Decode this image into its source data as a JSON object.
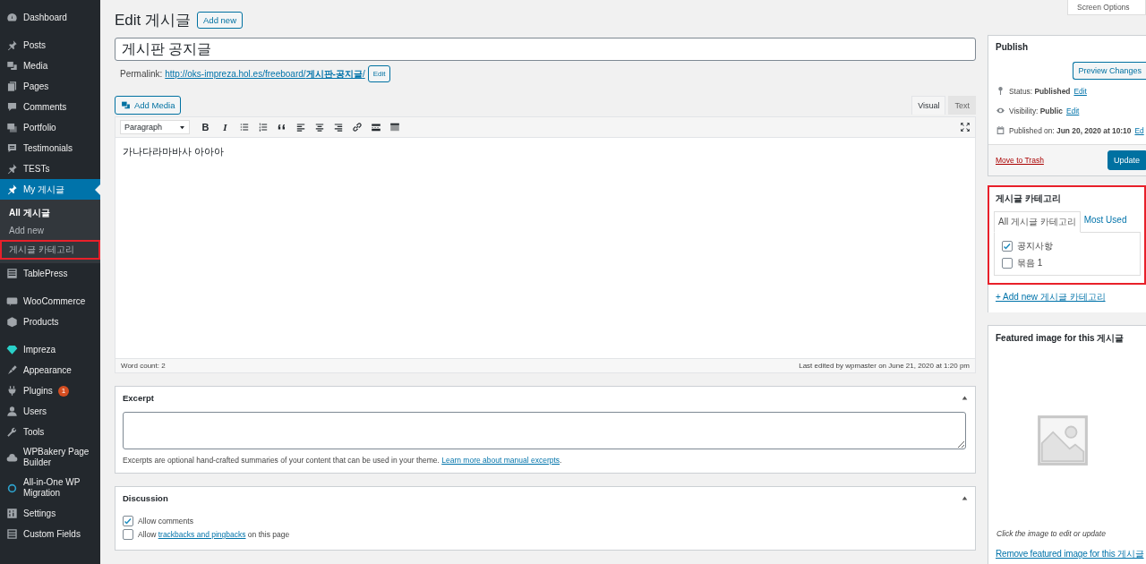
{
  "sidebar": {
    "groups": [
      [
        {
          "label": "Dashboard",
          "kind": "dashboard",
          "selected": false
        }
      ],
      [
        {
          "label": "Posts",
          "kind": "pin",
          "selected": false
        },
        {
          "label": "Media",
          "kind": "media",
          "selected": false
        },
        {
          "label": "Pages",
          "kind": "pages",
          "selected": false
        },
        {
          "label": "Comments",
          "kind": "comment",
          "selected": false
        },
        {
          "label": "Portfolio",
          "kind": "portfolio",
          "selected": false
        },
        {
          "label": "Testimonials",
          "kind": "testimonial",
          "selected": false
        },
        {
          "label": "TESTs",
          "kind": "pin",
          "selected": false
        },
        {
          "label": "My 게시글",
          "kind": "pin",
          "selected": true,
          "children": [
            {
              "label": "All 게시글",
              "selected": true,
              "highlighted": false
            },
            {
              "label": "Add new",
              "selected": false,
              "highlighted": false
            },
            {
              "label": "게시글 카테고리",
              "selected": false,
              "highlighted": true
            }
          ]
        },
        {
          "label": "TablePress",
          "kind": "table",
          "selected": false
        }
      ],
      [
        {
          "label": "WooCommerce",
          "kind": "woo",
          "selected": false
        },
        {
          "label": "Products",
          "kind": "box",
          "selected": false
        }
      ],
      [
        {
          "label": "Impreza",
          "kind": "gem",
          "selected": false
        },
        {
          "label": "Appearance",
          "kind": "brush",
          "selected": false
        },
        {
          "label": "Plugins",
          "kind": "plug",
          "selected": false,
          "badge": "1"
        },
        {
          "label": "Users",
          "kind": "user",
          "selected": false
        },
        {
          "label": "Tools",
          "kind": "wrench",
          "selected": false
        },
        {
          "label": "WPBakery Page Builder",
          "kind": "cloud",
          "selected": false
        },
        {
          "label": "All-in-One WP Migration",
          "kind": "migration",
          "selected": false
        },
        {
          "label": "Settings",
          "kind": "settings",
          "selected": false
        },
        {
          "label": "Custom Fields",
          "kind": "fields",
          "selected": false
        }
      ]
    ]
  },
  "page": {
    "title": "Edit 게시글",
    "add_new": "Add new",
    "post_title": "게시판 공지글",
    "permalink": {
      "label": "Permalink:",
      "url": "http://oks-impreza.hol.es/freeboard/**게시판-공지글**/",
      "edit": "Edit"
    },
    "add_media": "Add Media",
    "editor": {
      "tabs": [
        {
          "label": "Visual",
          "selected": true
        },
        {
          "label": "Text",
          "selected": false
        }
      ],
      "format": "Paragraph",
      "tools": [
        {
          "kind": "text",
          "label": "B"
        },
        {
          "kind": "italic",
          "label": "I"
        },
        {
          "kind": "bullets"
        },
        {
          "kind": "numbers"
        },
        {
          "kind": "quote"
        },
        {
          "kind": "align-left"
        },
        {
          "kind": "align-center"
        },
        {
          "kind": "align-right"
        },
        {
          "kind": "link"
        },
        {
          "kind": "more"
        },
        {
          "kind": "toolbar"
        }
      ],
      "content": "가나다라마바사 아아아",
      "word_count": "Word count: 2",
      "last_edited": "Last edited by wpmaster on June 21, 2020 at 1:20 pm"
    },
    "excerpt": {
      "title": "Excerpt",
      "help": "Excerpts are optional hand-crafted summaries of your content that can be used in your theme.",
      "link": "Learn more about manual excerpts",
      "after": "."
    },
    "discussion": {
      "title": "Discussion",
      "options": [
        {
          "text": "Allow comments",
          "checked": true
        },
        {
          "text": "Allow ",
          "link": "trackbacks and pingbacks",
          "after": " on this page",
          "checked": false
        }
      ]
    }
  },
  "screen_options": "Screen Options",
  "publish": {
    "title": "Publish",
    "preview": "Preview Changes",
    "rows": [
      {
        "kind": "status",
        "text": "Status: **Published**",
        "link": "Edit"
      },
      {
        "kind": "visibility",
        "text": "Visibility: **Public**",
        "link": "Edit"
      },
      {
        "kind": "date",
        "text": "Published on: **Jun 20, 2020 at 10:10**",
        "link": "Ed"
      }
    ],
    "trash": "Move to Trash",
    "update": "Update"
  },
  "categories": {
    "title": "게시글 카테고리",
    "highlighted": true,
    "tabs": [
      {
        "label": "All 게시글 카테고리",
        "selected": true
      },
      {
        "label": "Most Used",
        "selected": false
      }
    ],
    "items": [
      {
        "label": "공지사항",
        "checked": true
      },
      {
        "label": "묶음 1",
        "checked": false
      }
    ],
    "add": "+ Add new 게시글 카테고리"
  },
  "featured": {
    "title": "Featured image for this 게시글",
    "hint": "Click the image to edit or update",
    "remove": "Remove featured image for this 게시글"
  }
}
